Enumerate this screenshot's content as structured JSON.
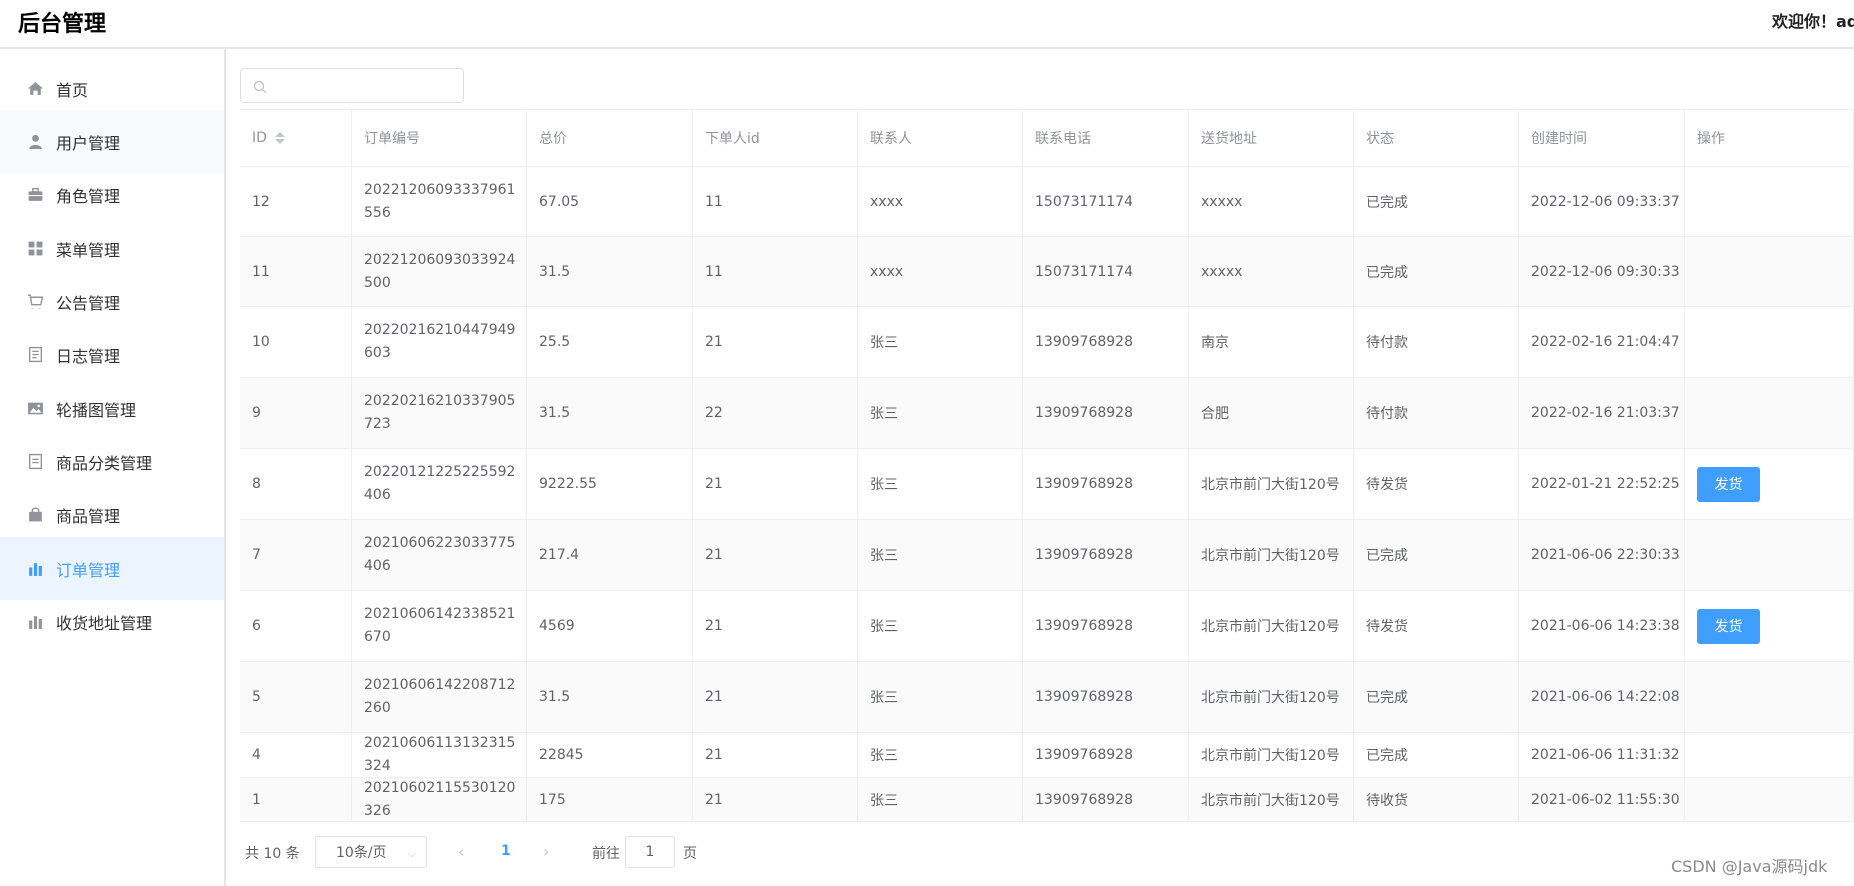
{
  "header": {
    "title": "后台管理",
    "welcome": "欢迎你！ad"
  },
  "sidebar": {
    "items": [
      {
        "label": "首页",
        "icon": "home-icon"
      },
      {
        "label": "用户管理",
        "icon": "user-icon"
      },
      {
        "label": "角色管理",
        "icon": "briefcase-icon"
      },
      {
        "label": "菜单管理",
        "icon": "grid-icon"
      },
      {
        "label": "公告管理",
        "icon": "cart-icon"
      },
      {
        "label": "日志管理",
        "icon": "document-icon"
      },
      {
        "label": "轮播图管理",
        "icon": "picture-icon"
      },
      {
        "label": "商品分类管理",
        "icon": "tickets-icon"
      },
      {
        "label": "商品管理",
        "icon": "shopping-bag-icon"
      },
      {
        "label": "订单管理",
        "icon": "bar-chart-icon"
      },
      {
        "label": "收货地址管理",
        "icon": "bar-chart-icon"
      }
    ],
    "active": "订单管理",
    "hovered": "用户管理"
  },
  "search": {
    "placeholder": "",
    "value": ""
  },
  "table": {
    "headers": [
      "ID",
      "订单编号",
      "总价",
      "下单人id",
      "联系人",
      "联系电话",
      "送货地址",
      "状态",
      "创建时间",
      "操作"
    ],
    "rows": [
      {
        "id": "12",
        "order_no": "20221206093337961556",
        "total": "67.05",
        "user_id": "11",
        "contact": "xxxx",
        "phone": "15073171174",
        "address": "xxxxx",
        "status": "已完成",
        "created": "2022-12-06 09:33:37",
        "action": ""
      },
      {
        "id": "11",
        "order_no": "20221206093033924500",
        "total": "31.5",
        "user_id": "11",
        "contact": "xxxx",
        "phone": "15073171174",
        "address": "xxxxx",
        "status": "已完成",
        "created": "2022-12-06 09:30:33",
        "action": ""
      },
      {
        "id": "10",
        "order_no": "20220216210447949603",
        "total": "25.5",
        "user_id": "21",
        "contact": "张三",
        "phone": "13909768928",
        "address": "南京",
        "status": "待付款",
        "created": "2022-02-16 21:04:47",
        "action": ""
      },
      {
        "id": "9",
        "order_no": "20220216210337905723",
        "total": "31.5",
        "user_id": "22",
        "contact": "张三",
        "phone": "13909768928",
        "address": "合肥",
        "status": "待付款",
        "created": "2022-02-16 21:03:37",
        "action": ""
      },
      {
        "id": "8",
        "order_no": "20220121225225592406",
        "total": "9222.55",
        "user_id": "21",
        "contact": "张三",
        "phone": "13909768928",
        "address": "北京市前门大街120号",
        "status": "待发货",
        "created": "2022-01-21 22:52:25",
        "action": "发货"
      },
      {
        "id": "7",
        "order_no": "20210606223033775406",
        "total": "217.4",
        "user_id": "21",
        "contact": "张三",
        "phone": "13909768928",
        "address": "北京市前门大街120号",
        "status": "已完成",
        "created": "2021-06-06 22:30:33",
        "action": ""
      },
      {
        "id": "6",
        "order_no": "20210606142338521670",
        "total": "4569",
        "user_id": "21",
        "contact": "张三",
        "phone": "13909768928",
        "address": "北京市前门大街120号",
        "status": "待发货",
        "created": "2021-06-06 14:23:38",
        "action": "发货"
      },
      {
        "id": "5",
        "order_no": "20210606142208712260",
        "total": "31.5",
        "user_id": "21",
        "contact": "张三",
        "phone": "13909768928",
        "address": "北京市前门大街120号",
        "status": "已完成",
        "created": "2021-06-06 14:22:08",
        "action": ""
      },
      {
        "id": "4",
        "order_no": "20210606113132315324",
        "total": "22845",
        "user_id": "21",
        "contact": "张三",
        "phone": "13909768928",
        "address": "北京市前门大街120号",
        "status": "已完成",
        "created": "2021-06-06 11:31:32",
        "action": ""
      },
      {
        "id": "1",
        "order_no": "20210602115530120326",
        "total": "175",
        "user_id": "21",
        "contact": "张三",
        "phone": "13909768928",
        "address": "北京市前门大街120号",
        "status": "待收货",
        "created": "2021-06-02 11:55:30",
        "action": ""
      }
    ]
  },
  "pagination": {
    "total": "共 10 条",
    "page_size": "10条/页",
    "current": "1",
    "goto_label": "前往",
    "goto_value": "1",
    "page_suffix": "页"
  },
  "watermark": "CSDN @Java源码jdk",
  "colors": {
    "accent": "#409eff",
    "border": "#ebeef5",
    "text": "#606266",
    "muted": "#909399"
  }
}
